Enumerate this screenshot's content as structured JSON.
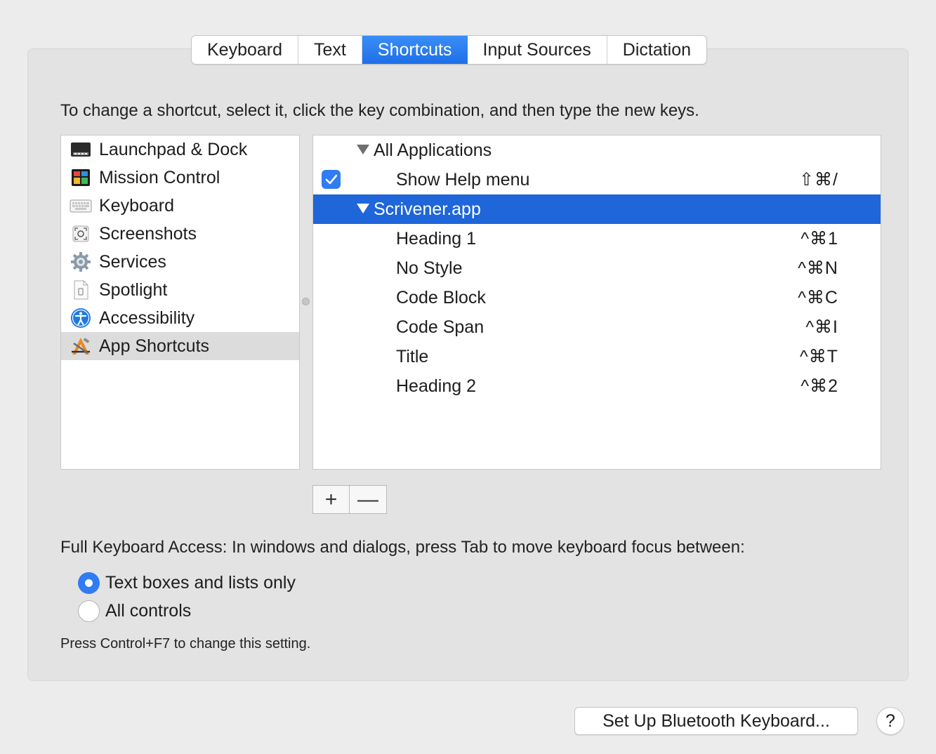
{
  "tabs": [
    {
      "label": "Keyboard"
    },
    {
      "label": "Text"
    },
    {
      "label": "Shortcuts"
    },
    {
      "label": "Input Sources"
    },
    {
      "label": "Dictation"
    }
  ],
  "active_tab": "Shortcuts",
  "instruction": "To change a shortcut, select it, click the key combination, and then type the new keys.",
  "categories": [
    {
      "label": "Launchpad & Dock",
      "icon": "launchpad-dock-icon"
    },
    {
      "label": "Mission Control",
      "icon": "mission-control-icon"
    },
    {
      "label": "Keyboard",
      "icon": "keyboard-icon"
    },
    {
      "label": "Screenshots",
      "icon": "screenshot-icon"
    },
    {
      "label": "Services",
      "icon": "gear-icon"
    },
    {
      "label": "Spotlight",
      "icon": "spotlight-icon"
    },
    {
      "label": "Accessibility",
      "icon": "accessibility-icon"
    },
    {
      "label": "App Shortcuts",
      "icon": "app-shortcuts-icon"
    }
  ],
  "selected_category": "App Shortcuts",
  "shortcuts": {
    "group_all": "All Applications",
    "all_items": [
      {
        "name": "Show Help menu",
        "keys": "⇧⌘/",
        "checked": true
      }
    ],
    "group_app": "Scrivener.app",
    "app_items": [
      {
        "name": "Heading 1",
        "keys": "^⌘1"
      },
      {
        "name": "No Style",
        "keys": "^⌘N"
      },
      {
        "name": "Code Block",
        "keys": "^⌘C"
      },
      {
        "name": "Code Span",
        "keys": "^⌘I"
      },
      {
        "name": "Title",
        "keys": "^⌘T"
      },
      {
        "name": "Heading 2",
        "keys": "^⌘2"
      }
    ]
  },
  "buttons": {
    "add": "+",
    "remove": "—",
    "bluetooth": "Set Up Bluetooth Keyboard...",
    "help": "?"
  },
  "full_keyboard_access": {
    "label": "Full Keyboard Access: In windows and dialogs, press Tab to move keyboard focus between:",
    "options": [
      "Text boxes and lists only",
      "All controls"
    ],
    "selected": "Text boxes and lists only",
    "note": "Press Control+F7 to change this setting."
  },
  "colors": {
    "accent": "#2f7cf3",
    "selection": "#1e66d9",
    "panel_bg": "#e3e3e3",
    "window_bg": "#ececec"
  }
}
